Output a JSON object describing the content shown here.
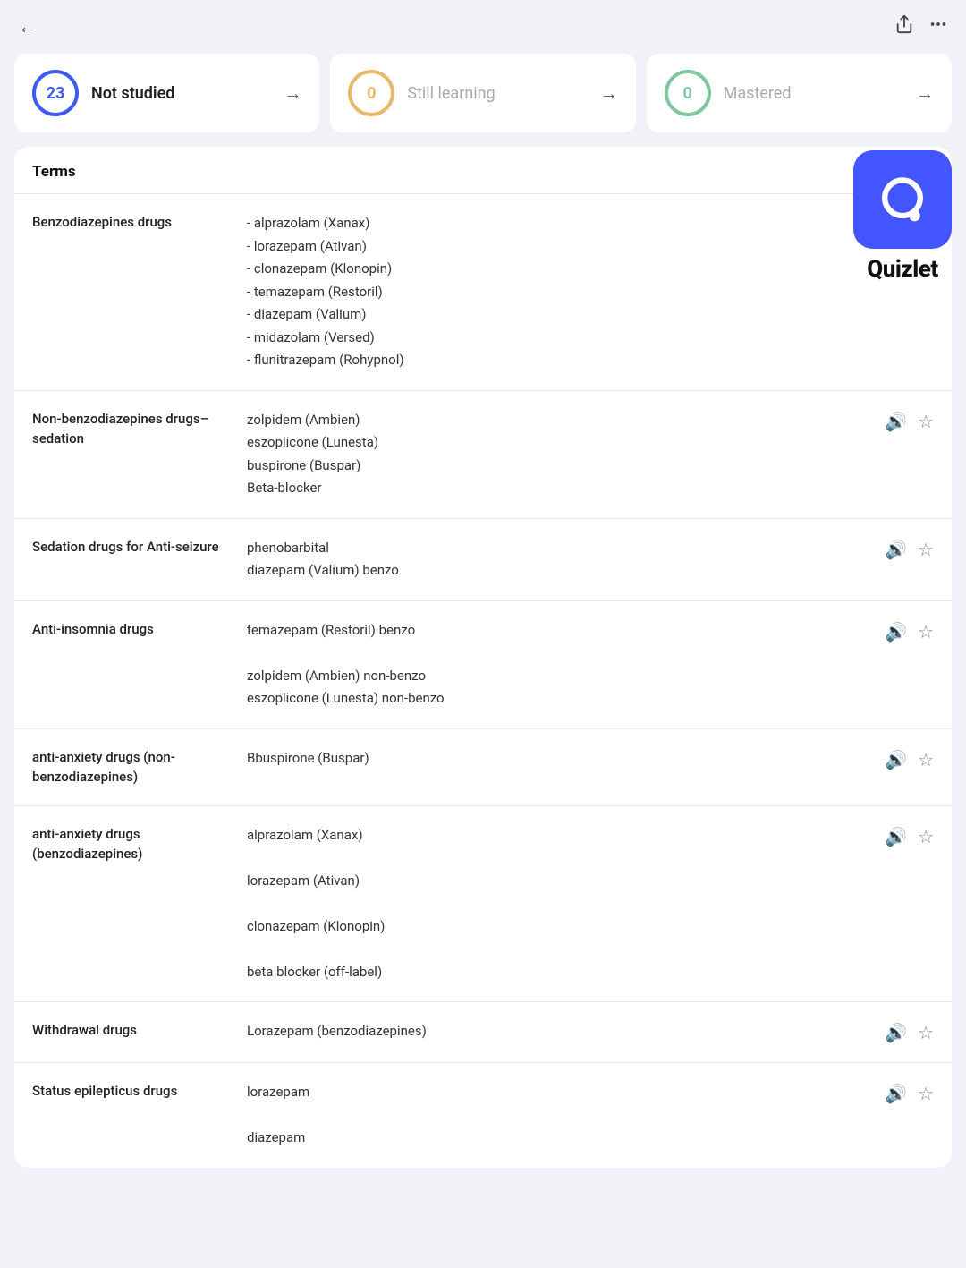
{
  "topbar": {
    "back_label": "←",
    "share_icon": "share",
    "more_icon": "more"
  },
  "status_cards": [
    {
      "id": "not-studied",
      "count": "23",
      "label": "Not studied",
      "circle_class": "circle-blue",
      "label_muted": false
    },
    {
      "id": "still-learning",
      "count": "0",
      "label": "Still learning",
      "circle_class": "circle-orange",
      "label_muted": true
    },
    {
      "id": "mastered",
      "count": "0",
      "label": "Mastered",
      "circle_class": "circle-green",
      "label_muted": true
    }
  ],
  "quizlet": {
    "wordmark": "Quizlet"
  },
  "terms_section": {
    "header": "Terms",
    "rows": [
      {
        "id": "row-benzodiazepines",
        "term": "Benzodiazepines drugs",
        "definition": "- alprazolam (Xanax)\n- lorazepam (Ativan)\n- clonazepam (Klonopin)\n- temazepam (Restoril)\n- diazepam (Valium)\n- midazolam (Versed)\n- flunitrazepam (Rohypnol)",
        "has_actions": false
      },
      {
        "id": "row-non-benzo-sedation",
        "term": "Non-benzodiazepines drugs–sedation",
        "definition": "zolpidem (Ambien)\neszoplicone (Lunesta)\nbuspirone (Buspar)\nBeta-blocker",
        "has_actions": true
      },
      {
        "id": "row-sedation-antiseizure",
        "term": "Sedation drugs for Anti-seizure",
        "definition": "phenobarbital\ndiazepam (Valium) benzo",
        "has_actions": true
      },
      {
        "id": "row-anti-insomnia",
        "term": "Anti-insomnia drugs",
        "definition": "temazepam (Restoril) benzo\n\nzolpidem (Ambien) non-benzo\neszoplicone (Lunesta) non-benzo",
        "has_actions": true
      },
      {
        "id": "row-anti-anxiety-non-benzo",
        "term": "anti-anxiety drugs (non-benzodiazepines)",
        "definition": "Bbuspirone (Buspar)",
        "has_actions": true
      },
      {
        "id": "row-anti-anxiety-benzo",
        "term": "anti-anxiety drugs (benzodiazepines)",
        "definition": "alprazolam (Xanax)\n\nlorazepam (Ativan)\n\nclonazepam (Klonopin)\n\nbeta blocker (off-label)",
        "has_actions": true
      },
      {
        "id": "row-withdrawal",
        "term": "Withdrawal drugs",
        "definition": "Lorazepam (benzodiazepines)",
        "has_actions": true
      },
      {
        "id": "row-status-epilepticus",
        "term": "Status epilepticus drugs",
        "definition": "lorazepam\n\ndiazepam",
        "has_actions": true
      }
    ]
  }
}
